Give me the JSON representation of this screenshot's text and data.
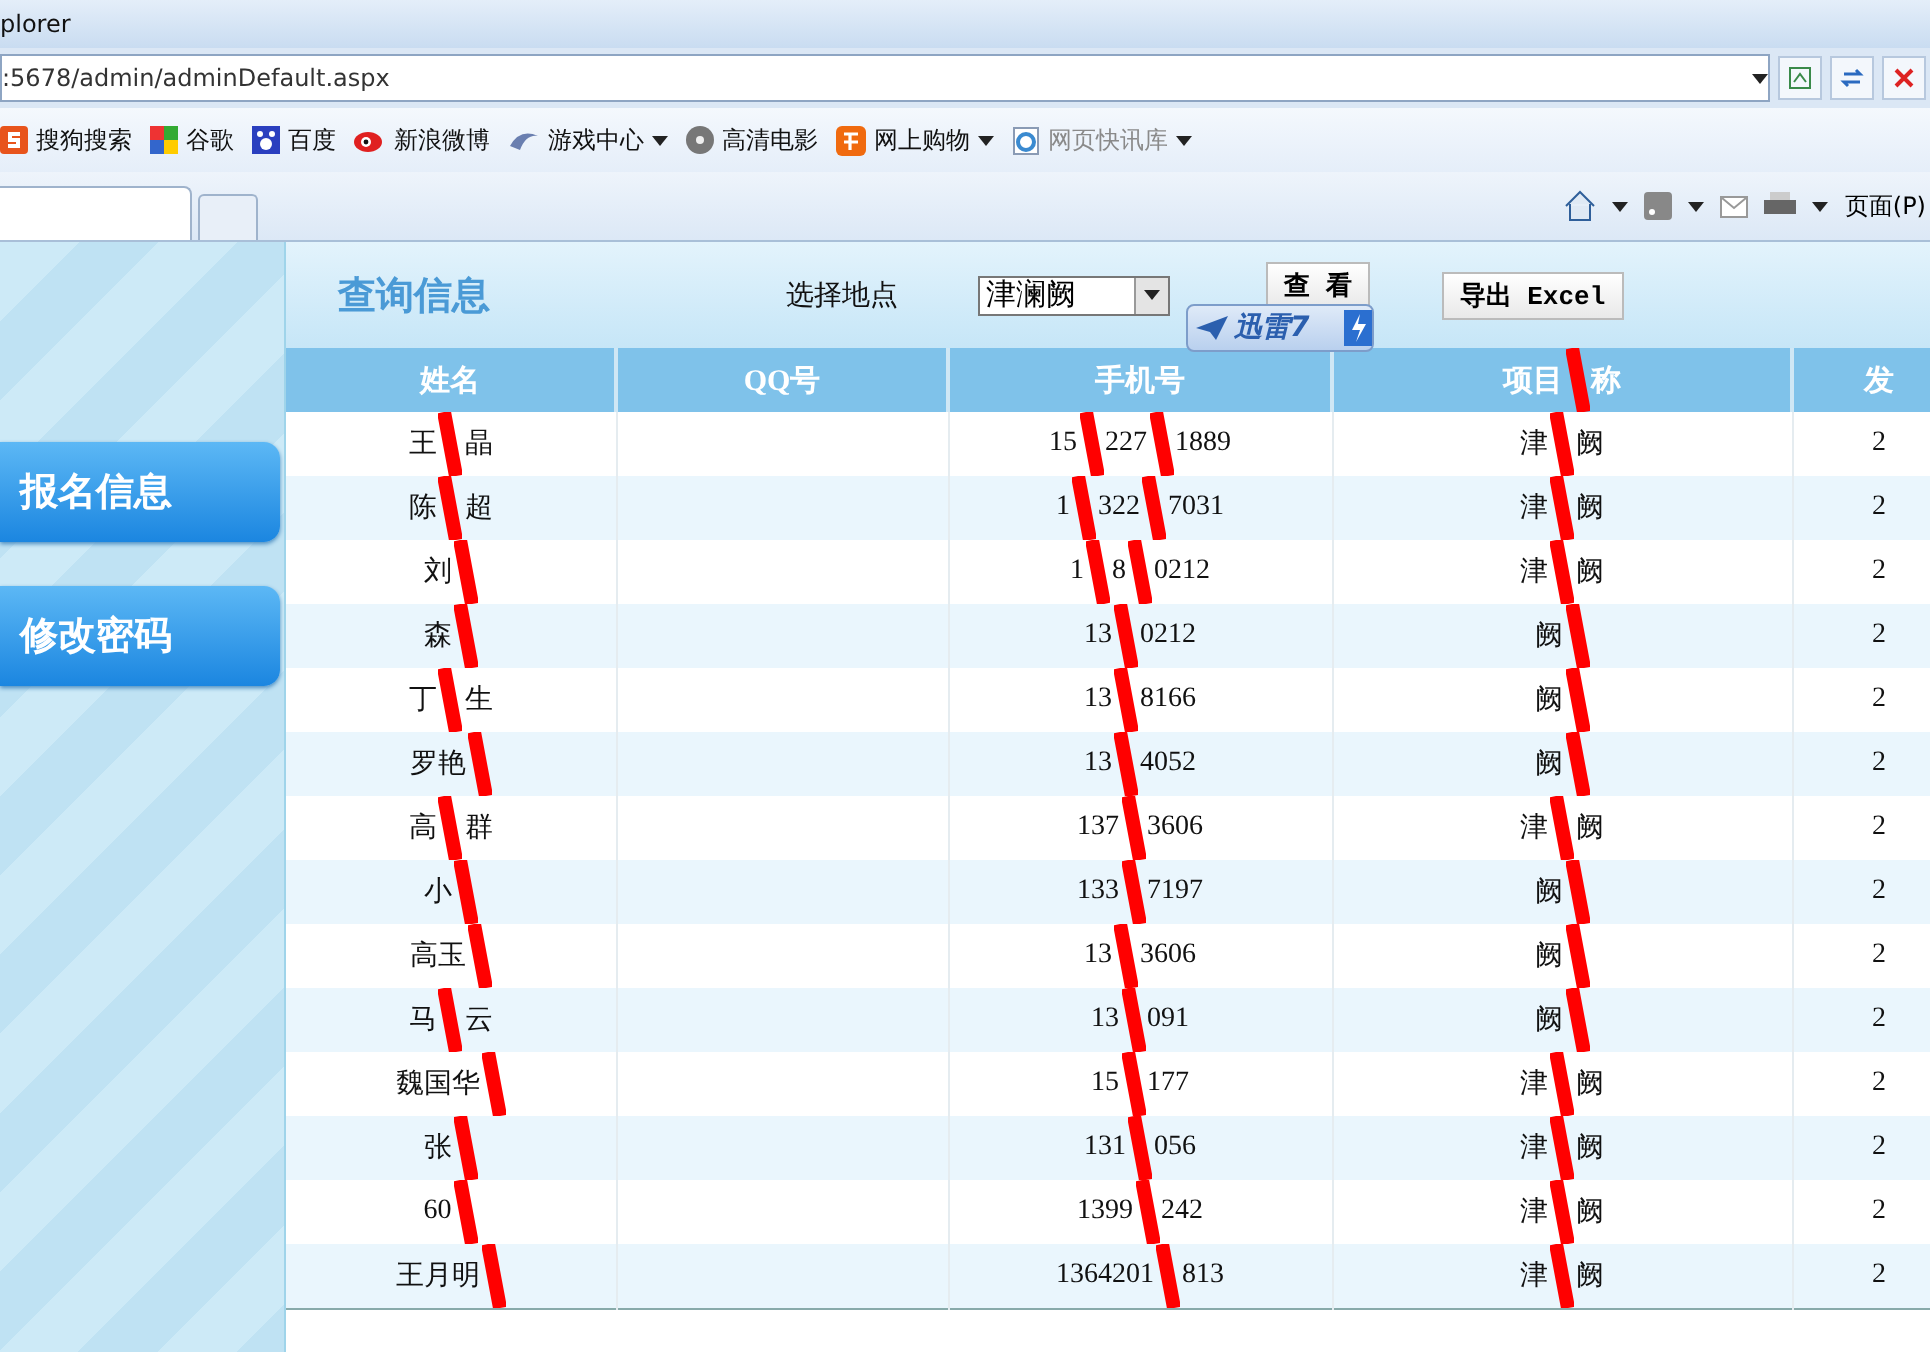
{
  "window": {
    "title": "plorer"
  },
  "address_bar": {
    "value": ":5678/admin/adminDefault.aspx"
  },
  "favorites": [
    {
      "label": "搜狗搜索",
      "dropdown": false,
      "disabled": false
    },
    {
      "label": "谷歌",
      "dropdown": false,
      "disabled": false
    },
    {
      "label": "百度",
      "dropdown": false,
      "disabled": false
    },
    {
      "label": "新浪微博",
      "dropdown": false,
      "disabled": false
    },
    {
      "label": "游戏中心",
      "dropdown": true,
      "disabled": false
    },
    {
      "label": "高清电影",
      "dropdown": false,
      "disabled": false
    },
    {
      "label": "网上购物",
      "dropdown": true,
      "disabled": false
    },
    {
      "label": "网页快讯库",
      "dropdown": true,
      "disabled": true
    }
  ],
  "command_bar": {
    "page_menu": "页面(P)"
  },
  "sidebar": {
    "items": [
      {
        "label": "报名信息"
      },
      {
        "label": "修改密码"
      }
    ]
  },
  "query": {
    "title": "查询信息",
    "location_label": "选择地点",
    "location_value": "津澜阙",
    "buttons": [
      "查 看",
      "导出 Excel"
    ]
  },
  "download_badge": {
    "label": "迅雷7"
  },
  "table": {
    "columns": [
      {
        "parts": [
          "姓名"
        ],
        "redacted": true
      },
      {
        "parts": [
          "QQ号"
        ]
      },
      {
        "parts": [
          "手机号"
        ],
        "redacted": true
      },
      {
        "parts": [
          "项目",
          "称"
        ],
        "redacted": true
      },
      {
        "parts": [
          "发"
        ],
        "redacted": false
      }
    ],
    "rows": [
      [
        [
          "王",
          "晶"
        ],
        [],
        [
          "15",
          "227",
          "1889"
        ],
        [
          "津",
          "阙"
        ],
        [
          "2"
        ]
      ],
      [
        [
          "陈",
          "超"
        ],
        [],
        [
          "1",
          "322",
          "7031"
        ],
        [
          "津",
          "阙"
        ],
        [
          "2"
        ]
      ],
      [
        [
          "刘"
        ],
        [],
        [
          "1",
          "8",
          "0212"
        ],
        [
          "津",
          "阙"
        ],
        [
          "2"
        ]
      ],
      [
        [
          "森"
        ],
        [],
        [
          "13",
          "0212"
        ],
        [
          "阙"
        ],
        [
          "2"
        ]
      ],
      [
        [
          "丁",
          "生"
        ],
        [],
        [
          "13",
          "8166"
        ],
        [
          "阙"
        ],
        [
          "2"
        ]
      ],
      [
        [
          "罗艳"
        ],
        [],
        [
          "13",
          "4052"
        ],
        [
          "阙"
        ],
        [
          "2"
        ]
      ],
      [
        [
          "高",
          "群"
        ],
        [],
        [
          "137",
          "3606"
        ],
        [
          "津",
          "阙"
        ],
        [
          "2"
        ]
      ],
      [
        [
          "小"
        ],
        [],
        [
          "133",
          "7197"
        ],
        [
          "阙"
        ],
        [
          "2"
        ]
      ],
      [
        [
          "高玉"
        ],
        [],
        [
          "13",
          "3606"
        ],
        [
          "阙"
        ],
        [
          "2"
        ]
      ],
      [
        [
          "马",
          "云"
        ],
        [],
        [
          "13",
          "091"
        ],
        [
          "阙"
        ],
        [
          "2"
        ]
      ],
      [
        [
          "魏国华"
        ],
        [],
        [
          "15",
          "177"
        ],
        [
          "津",
          "阙"
        ],
        [
          "2"
        ]
      ],
      [
        [
          "张"
        ],
        [],
        [
          "131",
          "056"
        ],
        [
          "津",
          "阙"
        ],
        [
          "2"
        ]
      ],
      [
        [
          "60"
        ],
        [],
        [
          "1399",
          "242"
        ],
        [
          "津",
          "阙"
        ],
        [
          "2"
        ]
      ],
      [
        [
          "王月明"
        ],
        [],
        [
          "1364201",
          "813"
        ],
        [
          "津",
          "阙"
        ],
        [
          "2"
        ]
      ]
    ]
  }
}
